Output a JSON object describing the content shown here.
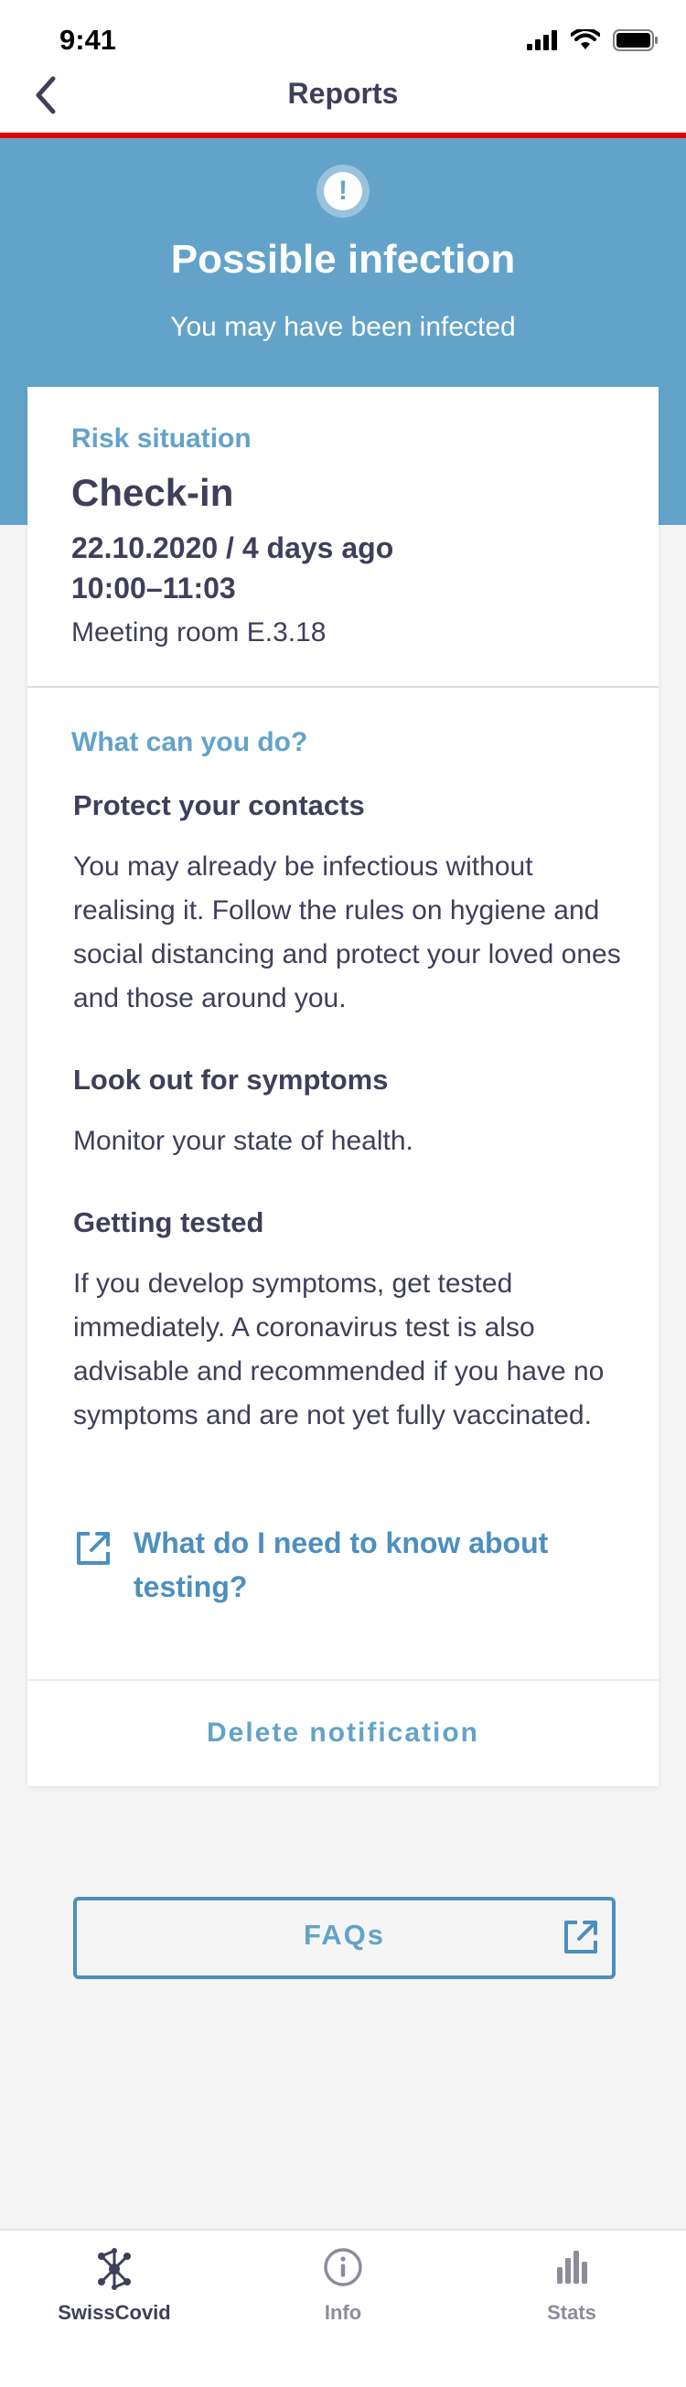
{
  "status_bar": {
    "time": "9:41"
  },
  "nav": {
    "title": "Reports"
  },
  "hero": {
    "title": "Possible infection",
    "subtitle": "You may have been infected",
    "icon_glyph": "!"
  },
  "risk": {
    "label": "Risk situation",
    "title": "Check-in",
    "date": "22.10.2020 / 4 days ago",
    "time": "10:00–11:03",
    "location": "Meeting room E.3.18"
  },
  "actions": {
    "label": "What can you do?",
    "blocks": [
      {
        "title": "Protect your contacts",
        "text": "You may already be infectious without realising it. Follow the rules on hygiene and social distancing and protect your loved ones and those around you."
      },
      {
        "title": "Look out for symptoms",
        "text": "Monitor your state of health."
      },
      {
        "title": "Getting tested",
        "text": "If you develop symptoms, get tested immediately. A coronavirus test is also advisable and recommended if you have no symptoms and are not yet fully vaccinated."
      }
    ],
    "link_text": "What do I need to know about testing?"
  },
  "delete_label": "Delete notification",
  "faq_label": "FAQs",
  "tabs": [
    {
      "label": "SwissCovid",
      "icon": "swisscovid-logo-icon",
      "active": true
    },
    {
      "label": "Info",
      "icon": "info-icon",
      "active": false
    },
    {
      "label": "Stats",
      "icon": "bar-chart-icon",
      "active": false
    }
  ],
  "colors": {
    "brand_blue": "#63a3c9",
    "link_blue": "#4d8fbf",
    "alert_red": "#e20008",
    "text_dark": "#3f3f5b",
    "tab_inactive": "#8c8c9c"
  }
}
